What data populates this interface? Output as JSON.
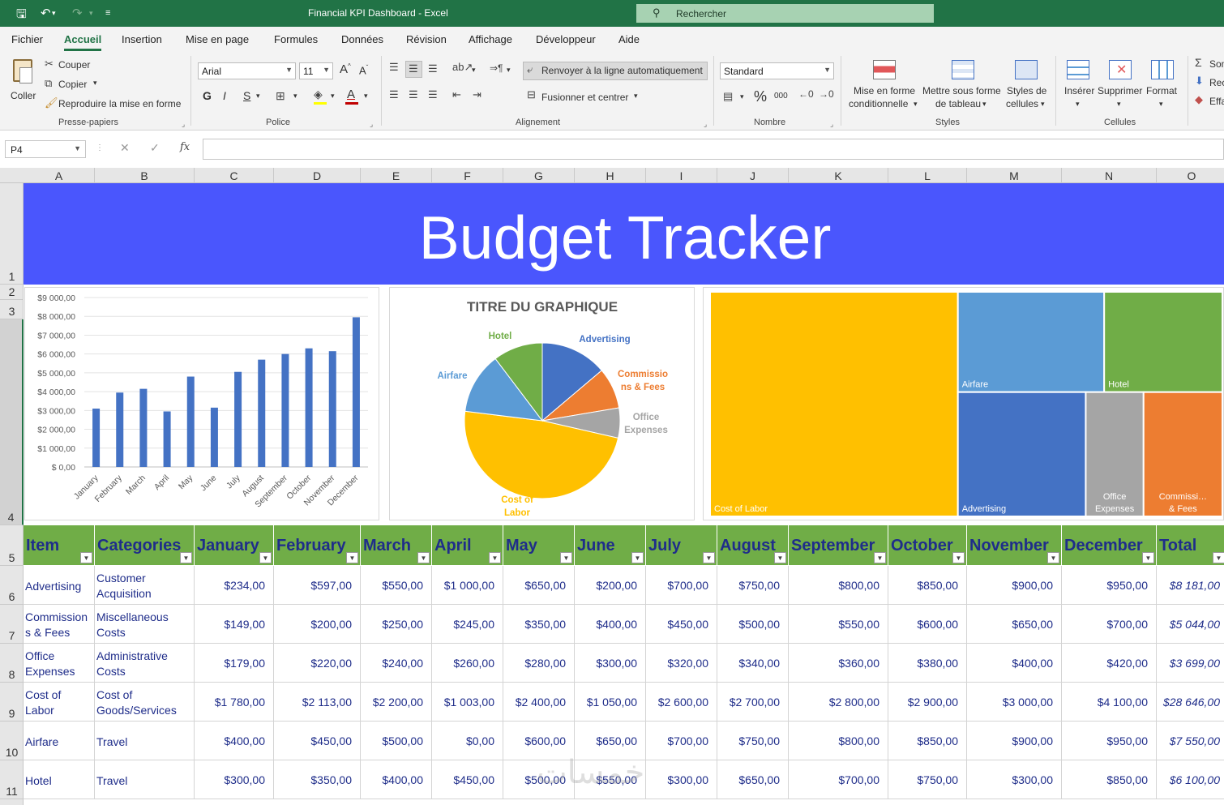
{
  "window": {
    "title": "Financial KPI Dashboard  -  Excel",
    "search_placeholder": "Rechercher"
  },
  "menu": {
    "tabs": [
      "Fichier",
      "Accueil",
      "Insertion",
      "Mise en page",
      "Formules",
      "Données",
      "Révision",
      "Affichage",
      "Développeur",
      "Aide"
    ],
    "active": "Accueil"
  },
  "ribbon": {
    "clipboard": {
      "paste": "Coller",
      "cut": "Couper",
      "copy": "Copier",
      "format_painter": "Reproduire la mise en forme",
      "group": "Presse-papiers"
    },
    "font": {
      "family": "Arial",
      "size": "11",
      "bold": "G",
      "italic": "I",
      "underline": "S",
      "group": "Police"
    },
    "alignment": {
      "wrap": "Renvoyer à la ligne automatiquement",
      "merge": "Fusionner et centrer",
      "group": "Alignement"
    },
    "number": {
      "format": "Standard",
      "percent": "%",
      "thousands": "000",
      "group": "Nombre"
    },
    "styles": {
      "conditional_l1": "Mise en forme",
      "conditional_l2": "conditionnelle",
      "table_l1": "Mettre sous forme",
      "table_l2": "de tableau",
      "cell_l1": "Styles de",
      "cell_l2": "cellules",
      "group": "Styles"
    },
    "cells": {
      "insert": "Insérer",
      "delete": "Supprimer",
      "format": "Format",
      "group": "Cellules"
    },
    "editing": {
      "sum": "Som",
      "fill": "Rec",
      "clear": "Effa"
    }
  },
  "formula_bar": {
    "name_box": "P4",
    "fx": "fx",
    "formula": ""
  },
  "columns": [
    "A",
    "B",
    "C",
    "D",
    "E",
    "F",
    "G",
    "H",
    "I",
    "J",
    "K",
    "L",
    "M",
    "N",
    "O"
  ],
  "rows": [
    "1",
    "2",
    "3",
    "4",
    "5",
    "6",
    "7",
    "8",
    "9",
    "10",
    "11"
  ],
  "banner": {
    "title": "Budget Tracker"
  },
  "chart_data": [
    {
      "type": "bar",
      "categories": [
        "January",
        "February",
        "March",
        "April",
        "May",
        "June",
        "July",
        "August",
        "September",
        "October",
        "November",
        "December"
      ],
      "values": [
        3100,
        3950,
        4150,
        2950,
        4800,
        3150,
        5050,
        5700,
        6000,
        6300,
        6150,
        7950
      ],
      "yticks": [
        "$ 0,00",
        "$1 000,00",
        "$2 000,00",
        "$3 000,00",
        "$4 000,00",
        "$5 000,00",
        "$6 000,00",
        "$7 000,00",
        "$8 000,00",
        "$9 000,00"
      ],
      "ylim": [
        0,
        9000
      ],
      "color": "#4472c4",
      "grid": true
    },
    {
      "type": "pie",
      "title": "TITRE DU GRAPHIQUE",
      "slices": [
        {
          "label": "Advertising",
          "value": 8181,
          "color": "#4472c4"
        },
        {
          "label": "Commissions & Fees",
          "value": 5044,
          "color": "#ed7d31"
        },
        {
          "label": "Office Expenses",
          "value": 3699,
          "color": "#a5a5a5"
        },
        {
          "label": "Cost of Labor",
          "value": 28646,
          "color": "#ffc000"
        },
        {
          "label": "Airfare",
          "value": 7550,
          "color": "#5b9bd5"
        },
        {
          "label": "Hotel",
          "value": 6100,
          "color": "#70ad47"
        }
      ],
      "labels": [
        {
          "lines": [
            "Advertising"
          ],
          "color": "#4472c4"
        },
        {
          "lines": [
            "Commissio",
            "ns & Fees"
          ],
          "color": "#ed7d31"
        },
        {
          "lines": [
            "Office",
            "Expenses"
          ],
          "color": "#a5a5a5"
        },
        {
          "lines": [
            "Cost of",
            "Labor"
          ],
          "color": "#ffc000"
        },
        {
          "lines": [
            "Airfare"
          ],
          "color": "#5b9bd5"
        },
        {
          "lines": [
            "Hotel"
          ],
          "color": "#70ad47"
        }
      ]
    },
    {
      "type": "treemap",
      "items": [
        {
          "label": "Cost of Labor",
          "lines": [
            "Cost of Labor"
          ],
          "value": 28646,
          "color": "#ffc000"
        },
        {
          "label": "Airfare",
          "lines": [
            "Airfare"
          ],
          "value": 7550,
          "color": "#5b9bd5"
        },
        {
          "label": "Hotel",
          "lines": [
            "Hotel"
          ],
          "value": 6100,
          "color": "#70ad47"
        },
        {
          "label": "Advertising",
          "lines": [
            "Advertising"
          ],
          "value": 8181,
          "color": "#4472c4"
        },
        {
          "label": "Office Expenses",
          "lines": [
            "Office",
            "Expenses"
          ],
          "value": 3699,
          "color": "#a5a5a5"
        },
        {
          "label": "Commissions & Fees",
          "lines": [
            "Commissi…",
            "& Fees"
          ],
          "value": 5044,
          "color": "#ed7d31"
        }
      ]
    }
  ],
  "table": {
    "headers": [
      "Item",
      "Categories",
      "January",
      "February",
      "March",
      "April",
      "May",
      "June",
      "July",
      "August",
      "September",
      "October",
      "November",
      "December",
      "Total"
    ],
    "rows": [
      {
        "item": [
          "Advertising"
        ],
        "category": [
          "Customer",
          "Acquisition"
        ],
        "values": [
          "$234,00",
          "$597,00",
          "$550,00",
          "$1 000,00",
          "$650,00",
          "$200,00",
          "$700,00",
          "$750,00",
          "$800,00",
          "$850,00",
          "$900,00",
          "$950,00"
        ],
        "total": "$8 181,00"
      },
      {
        "item": [
          "Commission",
          "s & Fees"
        ],
        "category": [
          "Miscellaneous",
          "Costs"
        ],
        "values": [
          "$149,00",
          "$200,00",
          "$250,00",
          "$245,00",
          "$350,00",
          "$400,00",
          "$450,00",
          "$500,00",
          "$550,00",
          "$600,00",
          "$650,00",
          "$700,00"
        ],
        "total": "$5 044,00"
      },
      {
        "item": [
          "Office",
          "Expenses"
        ],
        "category": [
          "Administrative",
          "Costs"
        ],
        "values": [
          "$179,00",
          "$220,00",
          "$240,00",
          "$260,00",
          "$280,00",
          "$300,00",
          "$320,00",
          "$340,00",
          "$360,00",
          "$380,00",
          "$400,00",
          "$420,00"
        ],
        "total": "$3 699,00"
      },
      {
        "item": [
          "Cost of",
          "Labor"
        ],
        "category": [
          "Cost of",
          "Goods/Services"
        ],
        "values": [
          "$1 780,00",
          "$2 113,00",
          "$2 200,00",
          "$1 003,00",
          "$2 400,00",
          "$1 050,00",
          "$2 600,00",
          "$2 700,00",
          "$2 800,00",
          "$2 900,00",
          "$3 000,00",
          "$4 100,00"
        ],
        "total": "$28 646,00"
      },
      {
        "item": [
          "Airfare"
        ],
        "category": [
          "Travel"
        ],
        "values": [
          "$400,00",
          "$450,00",
          "$500,00",
          "$0,00",
          "$600,00",
          "$650,00",
          "$700,00",
          "$750,00",
          "$800,00",
          "$850,00",
          "$900,00",
          "$950,00"
        ],
        "total": "$7 550,00"
      },
      {
        "item": [
          "Hotel"
        ],
        "category": [
          "Travel"
        ],
        "values": [
          "$300,00",
          "$350,00",
          "$400,00",
          "$450,00",
          "$500,00",
          "$550,00",
          "$300,00",
          "$650,00",
          "$700,00",
          "$750,00",
          "$300,00",
          "$850,00"
        ],
        "total": "$6 100,00"
      }
    ]
  },
  "colors": {
    "excel_green": "#217346",
    "banner": "#4a56fd",
    "table_header": "#70ad47",
    "cell_text": "#1f2d8a"
  },
  "watermark": "خمسات"
}
